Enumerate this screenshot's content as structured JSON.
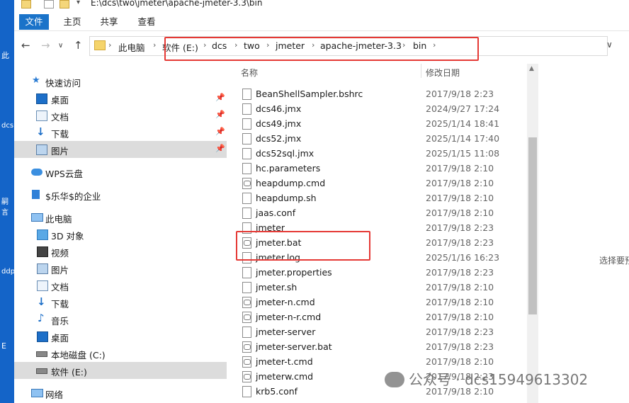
{
  "desktop": {
    "labels": [
      "此",
      "dcs",
      "嗣言",
      "ddp",
      "E"
    ]
  },
  "window": {
    "title_path": "E:\\dcs\\two\\jmeter\\apache-jmeter-3.3\\bin"
  },
  "ribbon": {
    "tabs": [
      "文件",
      "主页",
      "共享",
      "查看"
    ]
  },
  "nav": {
    "back": "←",
    "forward": "→",
    "down": "∨",
    "up": "↑",
    "dropdown": "∨"
  },
  "address": {
    "segments": [
      "此电脑",
      "软件 (E:)",
      "dcs",
      "two",
      "jmeter",
      "apache-jmeter-3.3",
      "bin"
    ],
    "separator": "›"
  },
  "sidebar": {
    "items": [
      {
        "label": "快速访问",
        "icon": "star-icon"
      },
      {
        "label": "桌面",
        "icon": "desktop-icon",
        "pinned": true
      },
      {
        "label": "文档",
        "icon": "document-icon",
        "pinned": true
      },
      {
        "label": "下载",
        "icon": "download-icon",
        "pinned": true
      },
      {
        "label": "图片",
        "icon": "picture-icon",
        "pinned": true,
        "selected": true
      },
      {
        "label": "WPS云盘",
        "icon": "cloud-icon"
      },
      {
        "label": "$乐华$的企业",
        "icon": "enterprise-icon"
      },
      {
        "label": "此电脑",
        "icon": "computer-icon"
      },
      {
        "label": "3D 对象",
        "icon": "cube-icon"
      },
      {
        "label": "视频",
        "icon": "video-icon"
      },
      {
        "label": "图片",
        "icon": "picture-icon"
      },
      {
        "label": "文档",
        "icon": "document-icon"
      },
      {
        "label": "下载",
        "icon": "download-icon"
      },
      {
        "label": "音乐",
        "icon": "music-icon"
      },
      {
        "label": "桌面",
        "icon": "desktop-icon"
      },
      {
        "label": "本地磁盘 (C:)",
        "icon": "drive-icon"
      },
      {
        "label": "软件 (E:)",
        "icon": "drive-icon",
        "selected": true
      },
      {
        "label": "网络",
        "icon": "network-icon"
      }
    ],
    "pin_glyph": "📌"
  },
  "filelist": {
    "columns": {
      "name": "名称",
      "date": "修改日期"
    },
    "rows": [
      {
        "name": "BeanShellSampler.bshrc",
        "date": "2017/9/18 2:23",
        "kind": "file"
      },
      {
        "name": "dcs46.jmx",
        "date": "2024/9/27 17:24",
        "kind": "file"
      },
      {
        "name": "dcs49.jmx",
        "date": "2025/1/14 18:41",
        "kind": "file"
      },
      {
        "name": "dcs52.jmx",
        "date": "2025/1/14 17:40",
        "kind": "file"
      },
      {
        "name": "dcs52sql.jmx",
        "date": "2025/1/15 11:08",
        "kind": "file"
      },
      {
        "name": "hc.parameters",
        "date": "2017/9/18 2:10",
        "kind": "file"
      },
      {
        "name": "heapdump.cmd",
        "date": "2017/9/18 2:10",
        "kind": "cmd"
      },
      {
        "name": "heapdump.sh",
        "date": "2017/9/18 2:10",
        "kind": "file"
      },
      {
        "name": "jaas.conf",
        "date": "2017/9/18 2:10",
        "kind": "file"
      },
      {
        "name": "jmeter",
        "date": "2017/9/18 2:23",
        "kind": "file"
      },
      {
        "name": "jmeter.bat",
        "date": "2017/9/18 2:23",
        "kind": "cmd"
      },
      {
        "name": "jmeter.log",
        "date": "2025/1/16 16:23",
        "kind": "file"
      },
      {
        "name": "jmeter.properties",
        "date": "2017/9/18 2:23",
        "kind": "file"
      },
      {
        "name": "jmeter.sh",
        "date": "2017/9/18 2:10",
        "kind": "file"
      },
      {
        "name": "jmeter-n.cmd",
        "date": "2017/9/18 2:10",
        "kind": "cmd"
      },
      {
        "name": "jmeter-n-r.cmd",
        "date": "2017/9/18 2:10",
        "kind": "cmd"
      },
      {
        "name": "jmeter-server",
        "date": "2017/9/18 2:23",
        "kind": "file"
      },
      {
        "name": "jmeter-server.bat",
        "date": "2017/9/18 2:23",
        "kind": "cmd"
      },
      {
        "name": "jmeter-t.cmd",
        "date": "2017/9/18 2:10",
        "kind": "cmd"
      },
      {
        "name": "jmeterw.cmd",
        "date": "2017/9/18 2:23",
        "kind": "cmd"
      },
      {
        "name": "krb5.conf",
        "date": "2017/9/18 2:10",
        "kind": "file"
      }
    ]
  },
  "preview": {
    "hint": "选择要预"
  },
  "watermark": {
    "text": "公众号 · dcs15949613302"
  },
  "colors": {
    "accent": "#1a73c9",
    "highlight": "#e53935",
    "selection": "#dcdcdc"
  }
}
